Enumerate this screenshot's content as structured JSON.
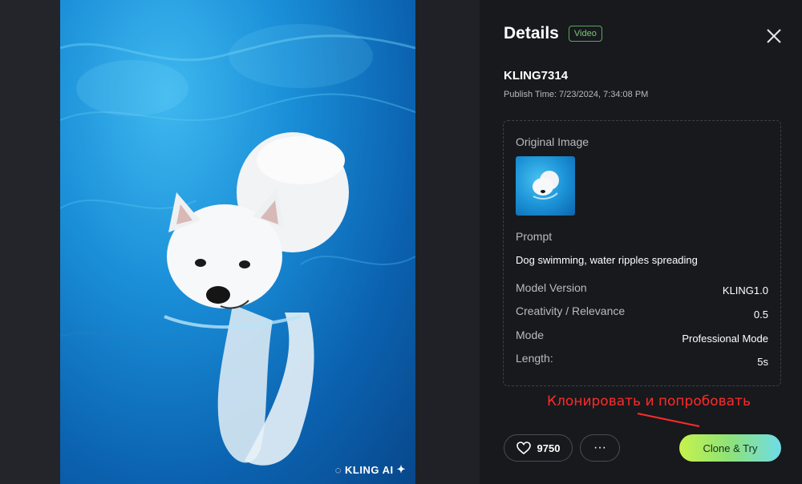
{
  "media": {
    "watermark": "KLING AI"
  },
  "details": {
    "title": "Details",
    "badge": "Video",
    "clip_id": "KLING7314",
    "publish_label": "Publish Time:",
    "publish_time": "7/23/2024, 7:34:08 PM",
    "original_image_label": "Original Image",
    "prompt_label": "Prompt",
    "prompt": "Dog swimming, water ripples spreading",
    "rows": [
      {
        "label": "Model Version",
        "value": "KLING1.0"
      },
      {
        "label": "Creativity / Relevance",
        "value": "0.5"
      },
      {
        "label": "Mode",
        "value": "Professional Mode"
      },
      {
        "label": "Length:",
        "value": "5s"
      }
    ]
  },
  "actions": {
    "likes": "9750",
    "more": "···",
    "clone_label": "Clone & Try"
  },
  "annotation": {
    "text": "Клонировать и попробовать",
    "color": "#ff2a2a"
  },
  "colors": {
    "accent_gradient_start": "#c6f24b",
    "accent_gradient_end": "#6fdce8",
    "badge_green": "#7cc57c"
  }
}
